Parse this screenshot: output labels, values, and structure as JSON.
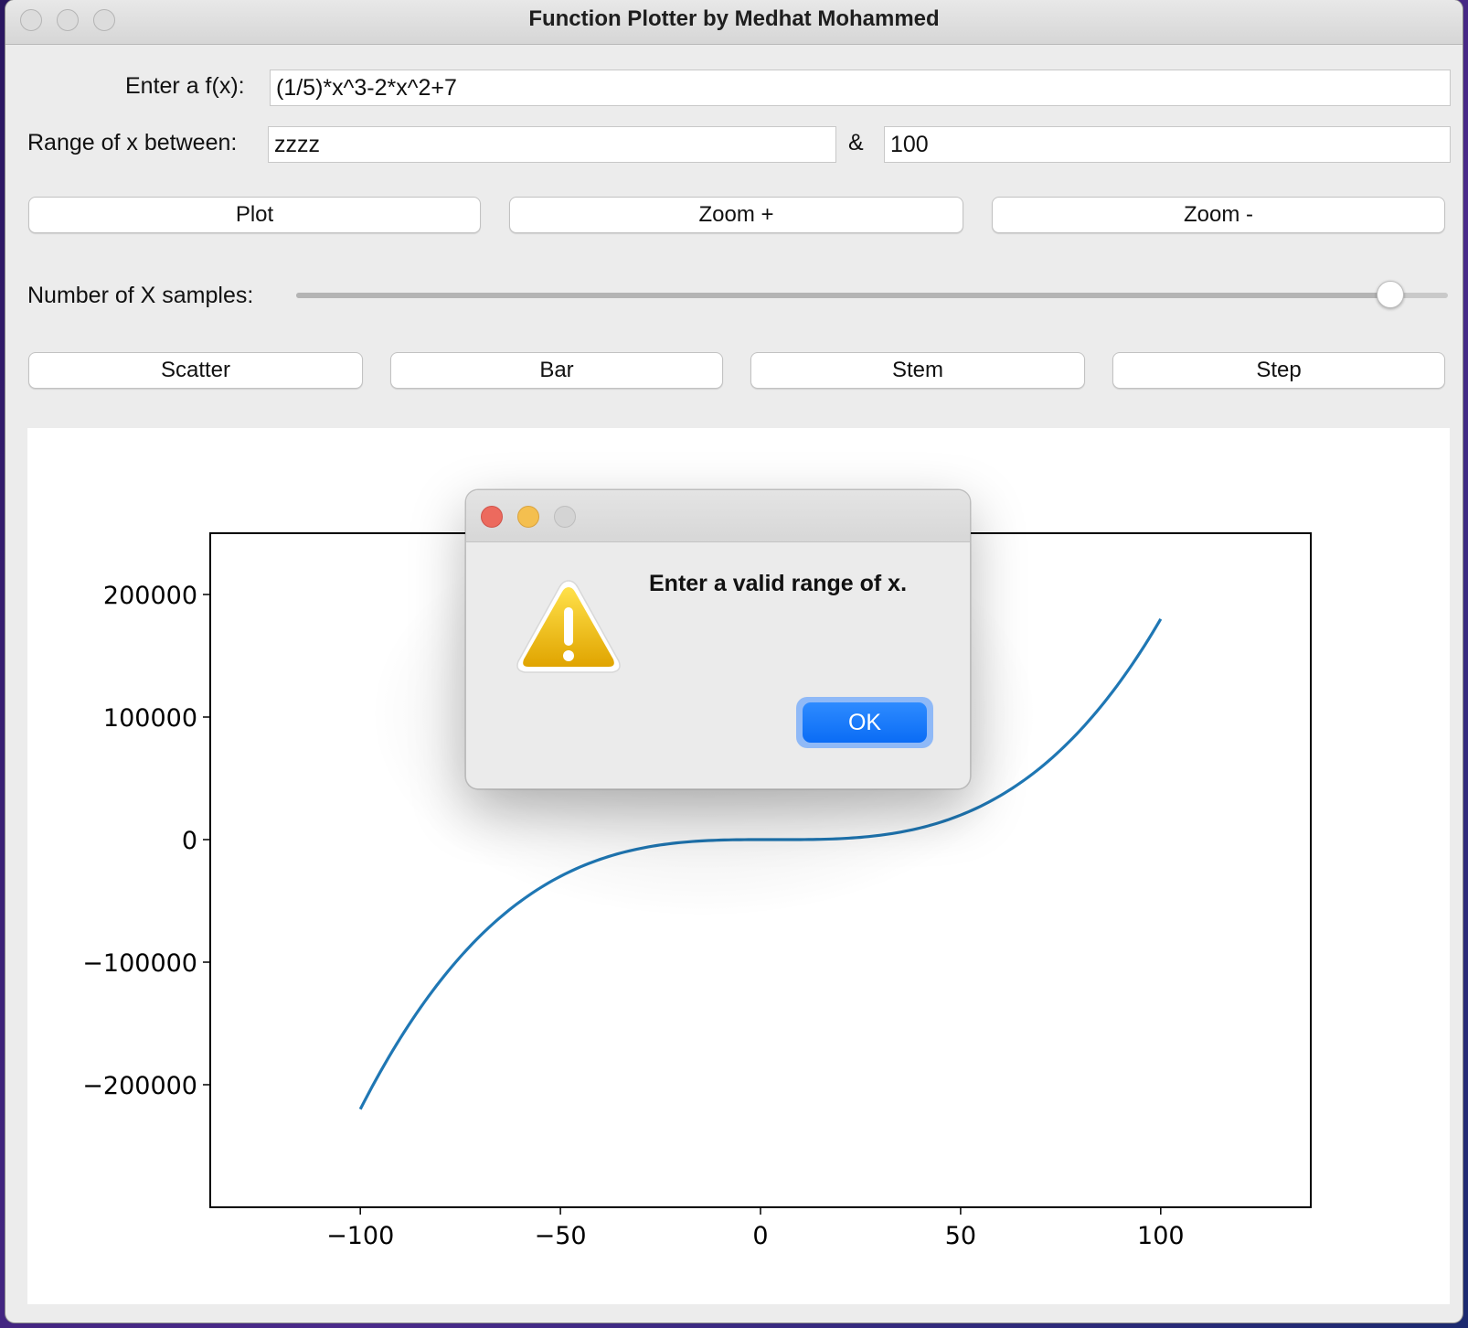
{
  "window": {
    "title": "Function Plotter by Medhat Mohammed"
  },
  "form": {
    "fx_label": "Enter a f(x):",
    "fx_value": "(1/5)*x^3-2*x^2+7",
    "range_label": "Range of x between:",
    "range_min_value": "zzzz",
    "range_separator": "&",
    "range_max_value": "100",
    "samples_label": "Number of X samples:",
    "samples_slider_level": 0.95
  },
  "buttons": {
    "plot": "Plot",
    "zoom_in": "Zoom +",
    "zoom_out": "Zoom -",
    "scatter": "Scatter",
    "bar": "Bar",
    "stem": "Stem",
    "step": "Step"
  },
  "dialog": {
    "message": "Enter a valid range of x.",
    "ok_label": "OK",
    "icon": "warning-triangle-icon",
    "colors": {
      "close": "#ec6a5e",
      "minimize": "#f4bf4f",
      "zoom": "#d4d4d4",
      "ok": "#0a6cf5"
    }
  },
  "chart_data": {
    "type": "line",
    "function": "(1/5)*x^3-2*x^2+7",
    "x_range": [
      -100,
      100
    ],
    "xlim": [
      -137.5,
      137.5
    ],
    "ylim": [
      -300000,
      250000
    ],
    "xticks": [
      -100,
      -50,
      0,
      50,
      100
    ],
    "xtick_labels": [
      "−100",
      "−50",
      "0",
      "50",
      "100"
    ],
    "yticks": [
      -200000,
      -100000,
      0,
      100000,
      200000
    ],
    "ytick_labels": [
      "−200000",
      "−100000",
      "0",
      "100000",
      "200000"
    ],
    "series_color": "#1f77b4",
    "grid": false
  }
}
